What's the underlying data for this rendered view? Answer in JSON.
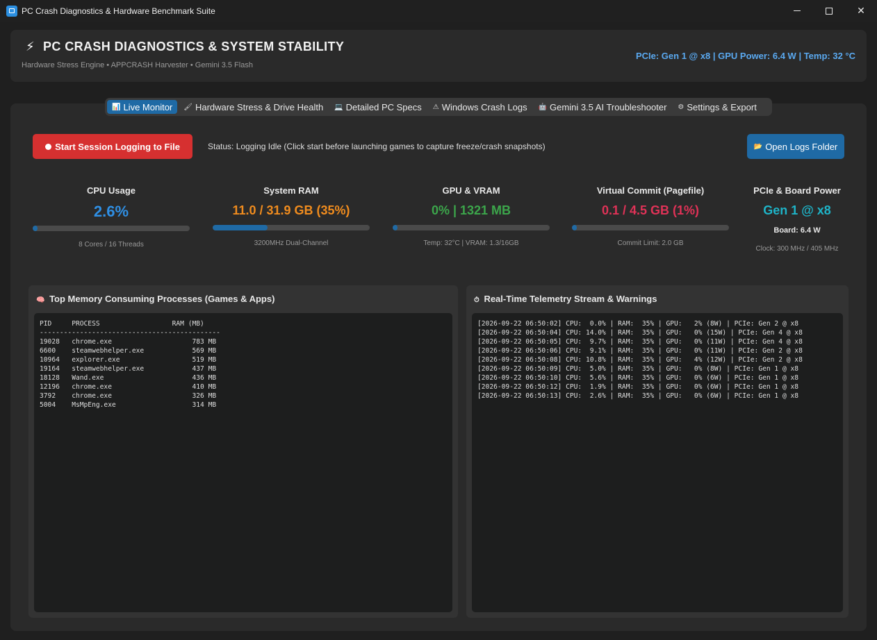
{
  "window": {
    "title": "PC Crash Diagnostics & Hardware Benchmark Suite",
    "app_icon": "app-window-icon",
    "controls": {
      "minimize_icon": "minimize-icon",
      "maximize_icon": "maximize-icon",
      "close_glyph": "✕"
    }
  },
  "header": {
    "icon": "⚡",
    "title": "PC CRASH DIAGNOSTICS & SYSTEM STABILITY",
    "subtitle": "Hardware Stress Engine • APPCRASH Harvester • Gemini 3.5 Flash",
    "status": "PCIe: Gen 1 @ x8 | GPU Power: 6.4 W | Temp: 32 °C"
  },
  "tabs": [
    {
      "icon": "📊",
      "label": "Live Monitor",
      "active": true
    },
    {
      "icon": "🖌",
      "label": "Hardware Stress & Drive Health",
      "active": false
    },
    {
      "icon": "💻",
      "label": "Detailed PC Specs",
      "active": false
    },
    {
      "icon": "⚠",
      "label": "Windows Crash Logs",
      "active": false
    },
    {
      "icon": "🤖",
      "label": "Gemini 3.5 AI Troubleshooter",
      "active": false
    },
    {
      "icon": "⚙",
      "label": "Settings & Export",
      "active": false
    }
  ],
  "controls": {
    "start_logging_label": "Start Session Logging to File",
    "status_text": "Status: Logging Idle (Click start before launching games to capture freeze/crash snapshots)",
    "open_logs_icon": "📂",
    "open_logs_label": "Open Logs Folder"
  },
  "metrics": {
    "cpu": {
      "label": "CPU Usage",
      "value": "2.6%",
      "percent": 2.6,
      "note": "8 Cores / 16 Threads",
      "color": "#2f8fe4"
    },
    "ram": {
      "label": "System RAM",
      "value": "11.0 / 31.9 GB (35%)",
      "percent": 35,
      "note": "3200MHz Dual-Channel",
      "color": "#f08c1e"
    },
    "gpu": {
      "label": "GPU & VRAM",
      "value": "0% | 1321 MB",
      "percent": 0,
      "note": "Temp: 32°C | VRAM: 1.3/16GB",
      "color": "#3ca64b"
    },
    "commit": {
      "label": "Virtual Commit (Pagefile)",
      "value": "0.1 / 4.5 GB (1%)",
      "percent": 1,
      "note": "Commit Limit: 2.0 GB",
      "color": "#e03257"
    },
    "pcie": {
      "label": "PCIe & Board Power",
      "value": "Gen 1 @ x8",
      "board": "Board: 6.4 W",
      "note": "Clock: 300 MHz / 405 MHz",
      "color": "#1eb4c8"
    }
  },
  "process_panel": {
    "icon": "🧠",
    "title": "Top Memory Consuming Processes (Games & Apps)",
    "lines": [
      "PID     PROCESS                  RAM (MB)",
      "---------------------------------------------",
      "19028   chrome.exe                    783 MB",
      "6600    steamwebhelper.exe            569 MB",
      "10964   explorer.exe                  519 MB",
      "19164   steamwebhelper.exe            437 MB",
      "18128   Wand.exe                      436 MB",
      "12196   chrome.exe                    410 MB",
      "3792    chrome.exe                    326 MB",
      "5004    MsMpEng.exe                   314 MB"
    ]
  },
  "telemetry_panel": {
    "icon": "⏱",
    "title": "Real-Time Telemetry Stream & Warnings",
    "lines": [
      "[2026-09-22 06:50:02] CPU:  0.0% | RAM:  35% | GPU:   2% (8W) | PCIe: Gen 2 @ x8",
      "[2026-09-22 06:50:04] CPU: 14.0% | RAM:  35% | GPU:   0% (15W) | PCIe: Gen 4 @ x8",
      "[2026-09-22 06:50:05] CPU:  9.7% | RAM:  35% | GPU:   0% (11W) | PCIe: Gen 4 @ x8",
      "[2026-09-22 06:50:06] CPU:  9.1% | RAM:  35% | GPU:   0% (11W) | PCIe: Gen 2 @ x8",
      "[2026-09-22 06:50:08] CPU: 10.8% | RAM:  35% | GPU:   4% (12W) | PCIe: Gen 2 @ x8",
      "[2026-09-22 06:50:09] CPU:  5.0% | RAM:  35% | GPU:   0% (8W) | PCIe: Gen 1 @ x8",
      "[2026-09-22 06:50:10] CPU:  5.6% | RAM:  35% | GPU:   0% (6W) | PCIe: Gen 1 @ x8",
      "[2026-09-22 06:50:12] CPU:  1.9% | RAM:  35% | GPU:   0% (6W) | PCIe: Gen 1 @ x8",
      "[2026-09-22 06:50:13] CPU:  2.6% | RAM:  35% | GPU:   0% (6W) | PCIe: Gen 1 @ x8"
    ]
  }
}
